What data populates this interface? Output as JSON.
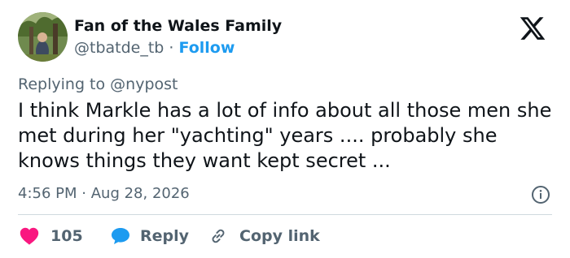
{
  "author": {
    "name": "Fan of the Wales Family",
    "handle": "@tbatde_tb",
    "separator": "·",
    "follow_label": "Follow"
  },
  "platform_icon": "x-logo-icon",
  "reply_context": {
    "prefix": "Replying to",
    "mention": "@nypost"
  },
  "tweet": {
    "text": "I think Markle has a lot of info about all those men she met during her \"yachting\" years .... probably she knows things they want kept secret ..."
  },
  "meta": {
    "time": "4:56 PM",
    "separator": "·",
    "date": "Aug 28, 2026"
  },
  "actions": {
    "like_count": "105",
    "reply_label": "Reply",
    "copy_label": "Copy link"
  },
  "colors": {
    "text": "#0f1419",
    "secondary": "#536471",
    "follow": "#1d9bf0",
    "heart": "#f91880",
    "reply_bubble": "#1d9bf0",
    "divider": "#cfd9de"
  }
}
